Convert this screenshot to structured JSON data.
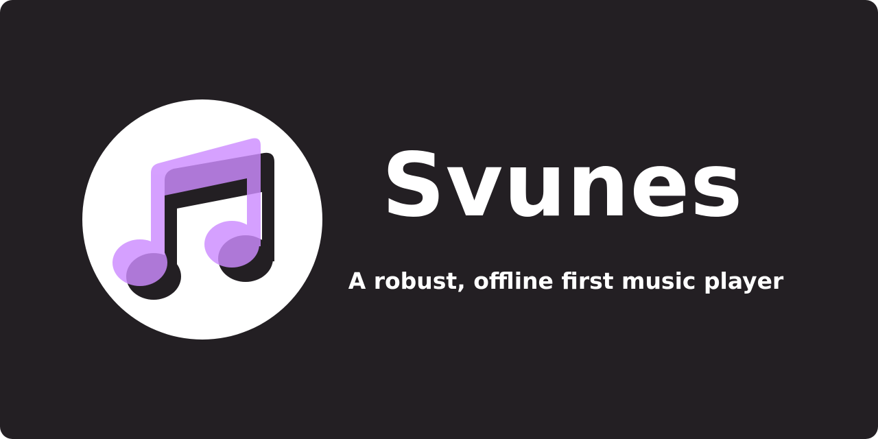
{
  "brand": {
    "name": "Svunes",
    "tagline": "A robust, offline first music player",
    "logo_icon": "music-note-icon"
  },
  "colors": {
    "background": "#231f23",
    "text": "#ffffff",
    "logo_circle": "#ffffff",
    "note_accent": "#cd8cff",
    "note_shadow": "#231f23"
  }
}
